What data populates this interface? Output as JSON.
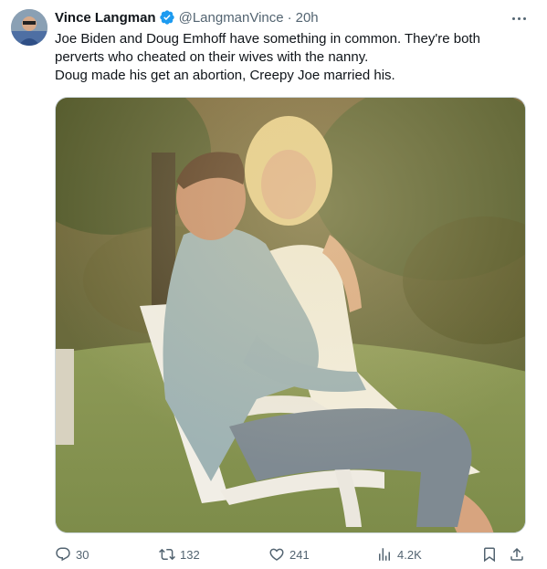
{
  "tweet": {
    "author_name": "Vince Langman",
    "handle": "@LangmanVince",
    "separator": "·",
    "time": "20h",
    "text_lines": [
      "Joe Biden and Doug Emhoff have something in common. They're both",
      "perverts who cheated on their wives with the nanny.",
      "Doug made his get an abortion, Creepy Joe married his."
    ]
  },
  "actions": {
    "replies": "30",
    "reposts": "132",
    "likes": "241",
    "views": "4.2K"
  },
  "icons": [
    "verified-badge-icon",
    "more-icon",
    "reply-icon",
    "repost-icon",
    "like-icon",
    "views-icon",
    "bookmark-icon",
    "share-icon"
  ],
  "colors": {
    "verified": "#1d9bf0",
    "muted": "#536471",
    "text": "#0f1419"
  }
}
